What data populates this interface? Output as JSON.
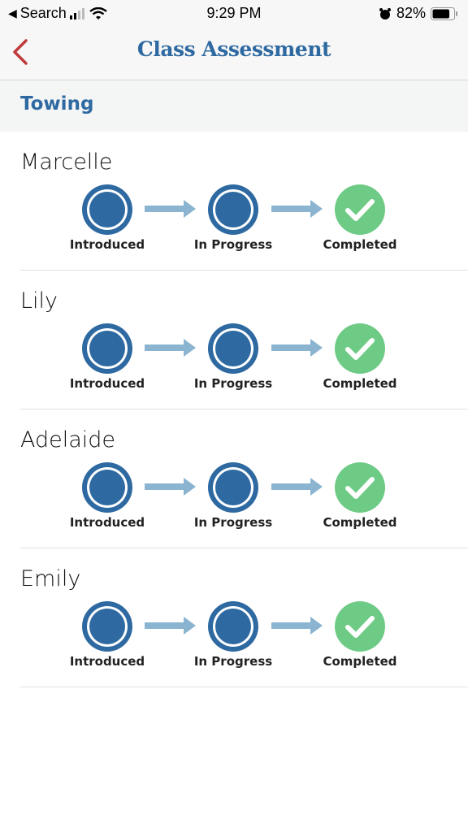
{
  "status_bar": {
    "back_app": "Search",
    "time": "9:29 PM",
    "battery": "82%",
    "battery_level": 0.82
  },
  "nav": {
    "title": "Class Assessment",
    "back_icon": "chevron-left-icon"
  },
  "section": {
    "title": "Towing"
  },
  "colors": {
    "accent": "#2e6aa1",
    "back": "#c0393b",
    "arrow": "#8ab4d0",
    "completed": "#6ecb85"
  },
  "steps": [
    "Introduced",
    "In Progress",
    "Completed"
  ],
  "students": [
    {
      "name": "Marcelle",
      "status": "Completed"
    },
    {
      "name": "Lily",
      "status": "Completed"
    },
    {
      "name": "Adelaide",
      "status": "Completed"
    },
    {
      "name": "Emily",
      "status": "Completed"
    }
  ]
}
